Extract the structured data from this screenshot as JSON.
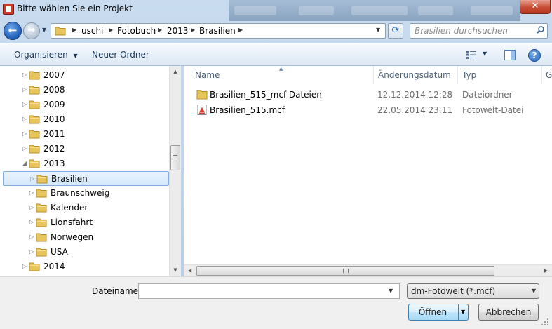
{
  "window": {
    "title": "Bitte wählen Sie ein Projekt",
    "close_label": "✕"
  },
  "nav": {
    "back_label": "←",
    "forward_label": "→",
    "breadcrumbs": [
      "uschi",
      "Fotobuch",
      "2013",
      "Brasilien"
    ],
    "search_placeholder": "Brasilien durchsuchen"
  },
  "toolbar": {
    "organize_label": "Organisieren",
    "new_folder_label": "Neuer Ordner",
    "help_label": "?"
  },
  "tree": {
    "items": [
      {
        "label": "2007",
        "level": 0,
        "expanded": false,
        "selected": false
      },
      {
        "label": "2008",
        "level": 0,
        "expanded": false,
        "selected": false
      },
      {
        "label": "2009",
        "level": 0,
        "expanded": false,
        "selected": false
      },
      {
        "label": "2010",
        "level": 0,
        "expanded": false,
        "selected": false
      },
      {
        "label": "2011",
        "level": 0,
        "expanded": false,
        "selected": false
      },
      {
        "label": "2012",
        "level": 0,
        "expanded": false,
        "selected": false
      },
      {
        "label": "2013",
        "level": 0,
        "expanded": true,
        "selected": false
      },
      {
        "label": "Brasilien",
        "level": 1,
        "expanded": false,
        "selected": true
      },
      {
        "label": "Braunschweig",
        "level": 1,
        "expanded": false,
        "selected": false
      },
      {
        "label": "Kalender",
        "level": 1,
        "expanded": false,
        "selected": false
      },
      {
        "label": "Lionsfahrt",
        "level": 1,
        "expanded": false,
        "selected": false
      },
      {
        "label": "Norwegen",
        "level": 1,
        "expanded": false,
        "selected": false
      },
      {
        "label": "USA",
        "level": 1,
        "expanded": false,
        "selected": false
      },
      {
        "label": "2014",
        "level": 0,
        "expanded": false,
        "selected": false
      }
    ]
  },
  "list": {
    "columns": [
      "Name",
      "Änderungsdatum",
      "Typ",
      "G"
    ],
    "files": [
      {
        "name": "Brasilien_515_mcf-Dateien",
        "date": "12.12.2014 12:28",
        "type": "Dateiordner",
        "icon": "folder-icon"
      },
      {
        "name": "Brasilien_515.mcf",
        "date": "22.05.2014 23:11",
        "type": "Fotowelt-Datei",
        "icon": "mcf-file-icon"
      }
    ]
  },
  "bottom": {
    "filename_label": "Dateiname:",
    "filename_value": "",
    "filter_value": "dm-Fotowelt (*.mcf)",
    "open_label": "Öffnen",
    "cancel_label": "Abbrechen"
  },
  "colors": {
    "folder": "#e8c55a",
    "selection": "#d3e8fc",
    "accent": "#3c7fb1"
  }
}
